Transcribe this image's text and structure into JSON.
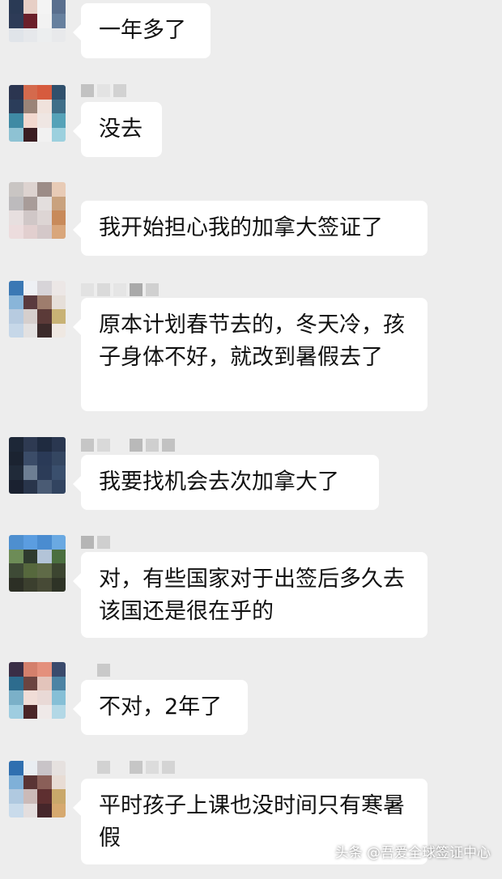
{
  "messages": [
    {
      "text": "一年多了"
    },
    {
      "text": "没去"
    },
    {
      "text": "我开始担心我的加拿大签证了"
    },
    {
      "text": "原本计划春节去的，冬天冷，孩子身体不好，就改到暑假去了"
    },
    {
      "text": "我要找机会去次加拿大了"
    },
    {
      "text": "对，有些国家对于出签后多久去该国还是很在乎的"
    },
    {
      "text": "不对，2年了"
    },
    {
      "text": "平时孩子上课也没时间只有寒暑假"
    }
  ],
  "watermark": "头条 @吾爱全球签证中心",
  "colors": {
    "background": "#ededed",
    "bubble": "#ffffff",
    "text": "#111111"
  }
}
